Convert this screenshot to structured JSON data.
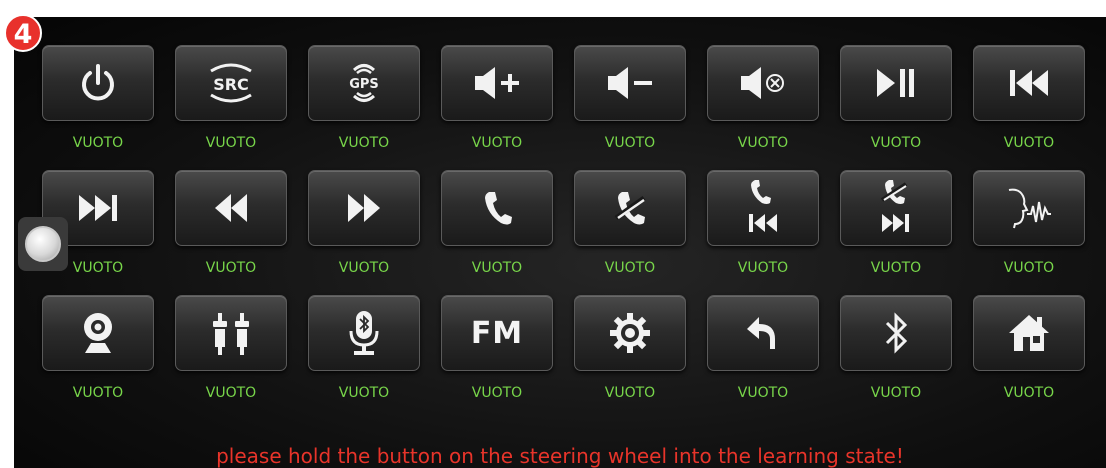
{
  "step_badge": "4",
  "empty_label": "VUOTO",
  "instruction": "please hold the button on the steering wheel into the learning state!",
  "buttons": [
    {
      "icon": "power-icon",
      "label": "VUOTO"
    },
    {
      "icon": "src-icon",
      "label": "VUOTO",
      "text": "SRC"
    },
    {
      "icon": "gps-icon",
      "label": "VUOTO",
      "text": "GPS"
    },
    {
      "icon": "volume-up-icon",
      "label": "VUOTO"
    },
    {
      "icon": "volume-down-icon",
      "label": "VUOTO"
    },
    {
      "icon": "mute-icon",
      "label": "VUOTO"
    },
    {
      "icon": "play-pause-icon",
      "label": "VUOTO"
    },
    {
      "icon": "previous-track-icon",
      "label": "VUOTO"
    },
    {
      "icon": "next-track-icon",
      "label": "VUOTO"
    },
    {
      "icon": "rewind-icon",
      "label": "VUOTO"
    },
    {
      "icon": "fast-forward-icon",
      "label": "VUOTO"
    },
    {
      "icon": "phone-answer-icon",
      "label": "VUOTO"
    },
    {
      "icon": "phone-hangup-icon",
      "label": "VUOTO"
    },
    {
      "icon": "phone-answer-previous-icon",
      "label": "VUOTO"
    },
    {
      "icon": "phone-hangup-next-icon",
      "label": "VUOTO"
    },
    {
      "icon": "voice-command-icon",
      "label": "VUOTO"
    },
    {
      "icon": "camera-icon",
      "label": "VUOTO"
    },
    {
      "icon": "aux-rca-icon",
      "label": "VUOTO"
    },
    {
      "icon": "bluetooth-mic-icon",
      "label": "VUOTO"
    },
    {
      "icon": "fm-icon",
      "label": "VUOTO",
      "text": "FM"
    },
    {
      "icon": "settings-gear-icon",
      "label": "VUOTO"
    },
    {
      "icon": "back-icon",
      "label": "VUOTO"
    },
    {
      "icon": "bluetooth-icon",
      "label": "VUOTO"
    },
    {
      "icon": "home-icon",
      "label": "VUOTO"
    }
  ]
}
